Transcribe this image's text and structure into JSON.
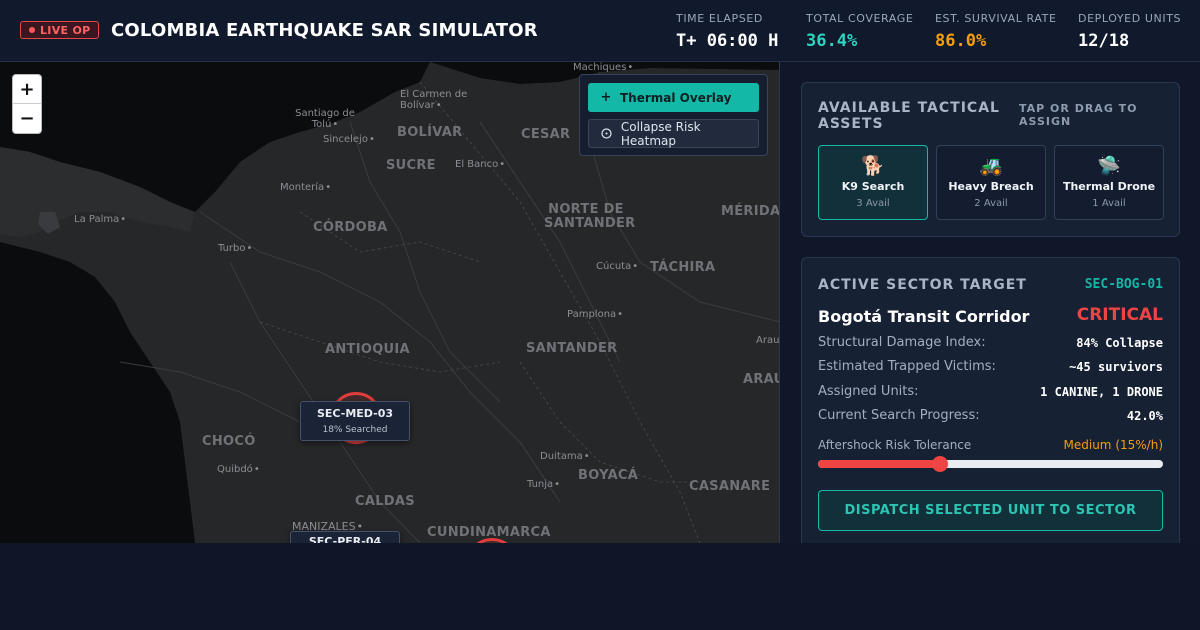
{
  "header": {
    "live_badge": "LIVE OP",
    "title": "COLOMBIA EARTHQUAKE SAR SIMULATOR",
    "stats": [
      {
        "label": "TIME ELAPSED",
        "value": "T+ 06:00 H",
        "color": "#ffffff"
      },
      {
        "label": "TOTAL COVERAGE",
        "value": "36.4%",
        "color": "#2dd4bf"
      },
      {
        "label": "EST. SURVIVAL RATE",
        "value": "86.0%",
        "color": "#f59e0b"
      },
      {
        "label": "DEPLOYED UNITS",
        "value": "12/18",
        "color": "#ffffff"
      }
    ]
  },
  "map": {
    "zoom_in": "+",
    "zoom_out": "−",
    "layers": {
      "thermal": {
        "icon": "plus-icon",
        "label": "Thermal Overlay"
      },
      "heatmap": {
        "icon": "circle-icon",
        "label": "Collapse Risk Heatmap"
      }
    },
    "regions": [
      "BOLÍVAR",
      "CESAR",
      "SUCRE",
      "CÓRDOBA",
      "NORTE DE SANTANDER",
      "MÉRIDA",
      "TÁCHIRA",
      "ANTIOQUIA",
      "SANTANDER",
      "ARAU",
      "CHOCÓ",
      "BOYACÁ",
      "CASANARE",
      "CALDAS",
      "CUNDINAMARCA"
    ],
    "cities": [
      "Machiques",
      "El Carmen de Bolívar",
      "Santiago de Tolú",
      "Sincelejo",
      "El Banco",
      "Montería",
      "La Palma",
      "Turbo",
      "Cúcuta",
      "Pamplona",
      "Arauca",
      "Duitama",
      "Tunja",
      "Quibdó",
      "MANIZALES"
    ],
    "sectors": [
      {
        "id": "SEC-MED-03",
        "progress": "18% Searched"
      },
      {
        "id": "SEC-PER-04",
        "progress": ""
      }
    ]
  },
  "assets_card": {
    "title": "AVAILABLE TACTICAL ASSETS",
    "hint": "TAP OR DRAG TO ASSIGN",
    "items": [
      {
        "icon": "🐕",
        "name": "K9 Search",
        "avail": "3 Avail"
      },
      {
        "icon": "🚜",
        "name": "Heavy Breach",
        "avail": "2 Avail"
      },
      {
        "icon": "🛸",
        "name": "Thermal Drone",
        "avail": "1 Avail"
      }
    ]
  },
  "target_card": {
    "title": "ACTIVE SECTOR TARGET",
    "sector_id": "SEC-BOG-01",
    "name": "Bogotá Transit Corridor",
    "status": "CRITICAL",
    "rows": [
      {
        "label": "Structural Damage Index:",
        "value": "84% Collapse"
      },
      {
        "label": "Estimated Trapped Victims:",
        "value": "~45 survivors"
      },
      {
        "label": "Assigned Units:",
        "value": "1 CANINE, 1 DRONE"
      },
      {
        "label": "Current Search Progress:",
        "value": "42.0%"
      }
    ],
    "slider_label": "Aftershock Risk Tolerance",
    "slider_value": "Medium (15%/h)",
    "slider_fraction": 0.355,
    "dispatch_label": "DISPATCH SELECTED UNIT TO SECTOR"
  },
  "colors": {
    "accent": "#14b8a6",
    "critical": "#ef4444",
    "warning": "#f59e0b"
  }
}
